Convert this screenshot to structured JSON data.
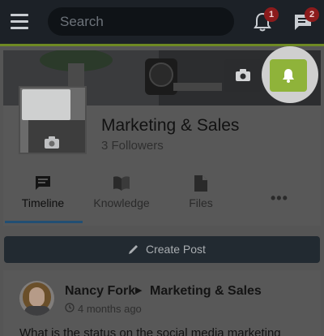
{
  "search": {
    "placeholder": "Search"
  },
  "notifications": {
    "count": "1"
  },
  "messages": {
    "count": "2"
  },
  "group": {
    "title": "Marketing & Sales",
    "followers": "3 Followers"
  },
  "tabs": [
    {
      "label": "Timeline",
      "icon": "timeline-icon",
      "active": true
    },
    {
      "label": "Knowledge",
      "icon": "book-icon"
    },
    {
      "label": "Files",
      "icon": "file-icon"
    },
    {
      "label": "•••",
      "icon": "more-icon"
    }
  ],
  "create_post": {
    "label": "Create Post"
  },
  "post": {
    "author": "Nancy Fork",
    "group": "Marketing & Sales",
    "time": "4 months ago",
    "text": "What is the status on the social media marketing"
  },
  "colors": {
    "accent": "#8fb33a",
    "topbar": "#1c2127",
    "badge": "#8c1b1c",
    "tab_underline": "#214e73"
  }
}
